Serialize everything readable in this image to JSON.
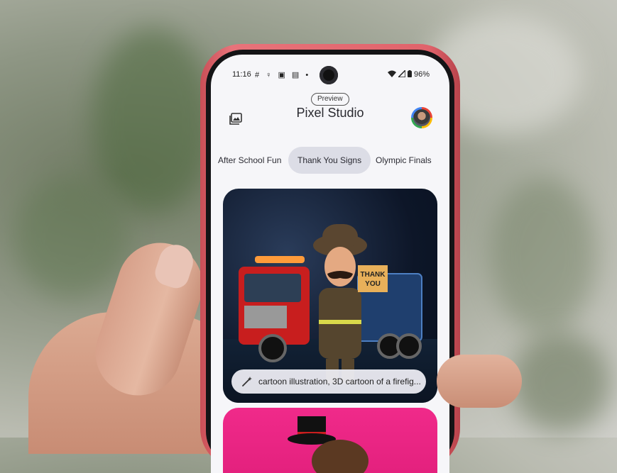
{
  "status_bar": {
    "time": "11:16",
    "notification_icons": "# ♀ ▣ ▤ •",
    "battery": "96%"
  },
  "header": {
    "badge": "Preview",
    "title": "Pixel Studio"
  },
  "tabs": [
    {
      "label": "After School Fun",
      "selected": false
    },
    {
      "label": "Thank You Signs",
      "selected": true
    },
    {
      "label": "Olympic Finals",
      "selected": false
    }
  ],
  "card": {
    "sign_text": "THANK YOU",
    "prompt": "cartoon illustration, 3D cartoon of a firefig..."
  },
  "colors": {
    "phone_frame": "#e0636b",
    "screen_bg": "#f6f6f9",
    "selected_tab_bg": "#dcdde6",
    "card2_bg": "#e01e7a"
  }
}
